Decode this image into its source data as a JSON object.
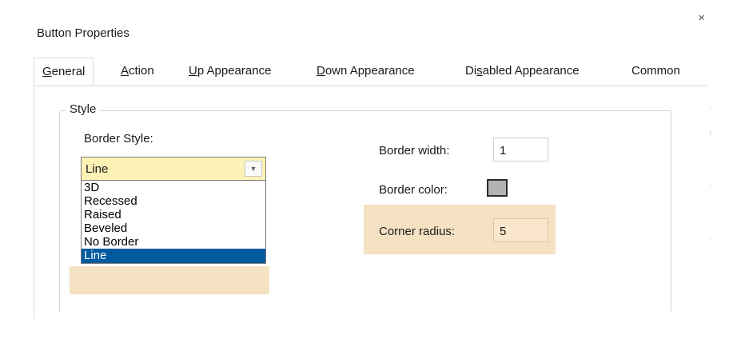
{
  "window": {
    "title": "Button Properties",
    "close_icon": "×"
  },
  "tabs": [
    {
      "pre": "",
      "ul": "G",
      "post": "eneral",
      "active": true
    },
    {
      "pre": "",
      "ul": "A",
      "post": "ction",
      "active": false
    },
    {
      "pre": "",
      "ul": "U",
      "post": "p Appearance",
      "active": false
    },
    {
      "pre": "",
      "ul": "D",
      "post": "own Appearance",
      "active": false
    },
    {
      "pre": "Di",
      "ul": "s",
      "post": "abled Appearance",
      "active": false
    },
    {
      "pre": "Common",
      "ul": "",
      "post": "",
      "active": false
    }
  ],
  "style_group": {
    "legend": "Style",
    "border_style_label": "Border Style:",
    "border_style_value": "Line",
    "border_style_options": [
      "3D",
      "Recessed",
      "Raised",
      "Beveled",
      "No Border",
      "Line"
    ],
    "selected_option": "Line",
    "border_width_label": "Border width:",
    "border_width_value": "1",
    "border_color_label": "Border color:",
    "border_color_hex": "#b3b3b3",
    "corner_radius_label": "Corner radius:",
    "corner_radius_value": "5"
  },
  "colors": {
    "highlight": "#f5e2c3",
    "combo_bg": "#fdf2b5",
    "selection": "#005a9e"
  }
}
